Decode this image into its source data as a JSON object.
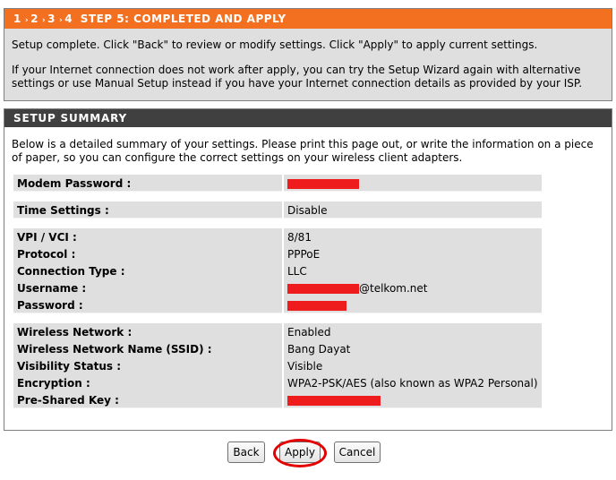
{
  "wizard": {
    "steps": [
      "1",
      "2",
      "3",
      "4"
    ],
    "title": "STEP 5: COMPLETED AND APPLY",
    "para1": "Setup complete. Click \"Back\" to review or modify settings. Click \"Apply\" to apply current settings.",
    "para2": "If your Internet connection does not work after apply, you can try the Setup Wizard again with alternative settings or use Manual Setup instead if you have your Internet connection details as provided by your ISP."
  },
  "summary": {
    "title": "SETUP SUMMARY",
    "intro": "Below is a detailed summary of your settings. Please print this page out, or write the information on a piece of paper, so you can configure the correct settings on your wireless client adapters.",
    "modem_password_label": "Modem Password :",
    "time_settings_label": "Time Settings :",
    "time_settings_value": "Disable",
    "vpi_vci_label": "VPI / VCI :",
    "vpi_vci_value": "8/81",
    "protocol_label": "Protocol :",
    "protocol_value": "PPPoE",
    "connection_type_label": "Connection Type :",
    "connection_type_value": "LLC",
    "username_label": "Username :",
    "username_suffix": "@telkom.net",
    "password_label": "Password :",
    "wireless_network_label": "Wireless Network :",
    "wireless_network_value": "Enabled",
    "ssid_label": "Wireless Network Name (SSID) :",
    "ssid_value": "Bang Dayat",
    "visibility_label": "Visibility Status :",
    "visibility_value": "Visible",
    "encryption_label": "Encryption :",
    "encryption_value": "WPA2-PSK/AES (also known as WPA2 Personal)",
    "psk_label": "Pre-Shared Key :"
  },
  "buttons": {
    "back": "Back",
    "apply": "Apply",
    "cancel": "Cancel"
  },
  "colors": {
    "header_orange": "#f37021",
    "header_dark": "#404040",
    "redaction": "#ee1c1c",
    "highlight_ring": "#e40000"
  }
}
